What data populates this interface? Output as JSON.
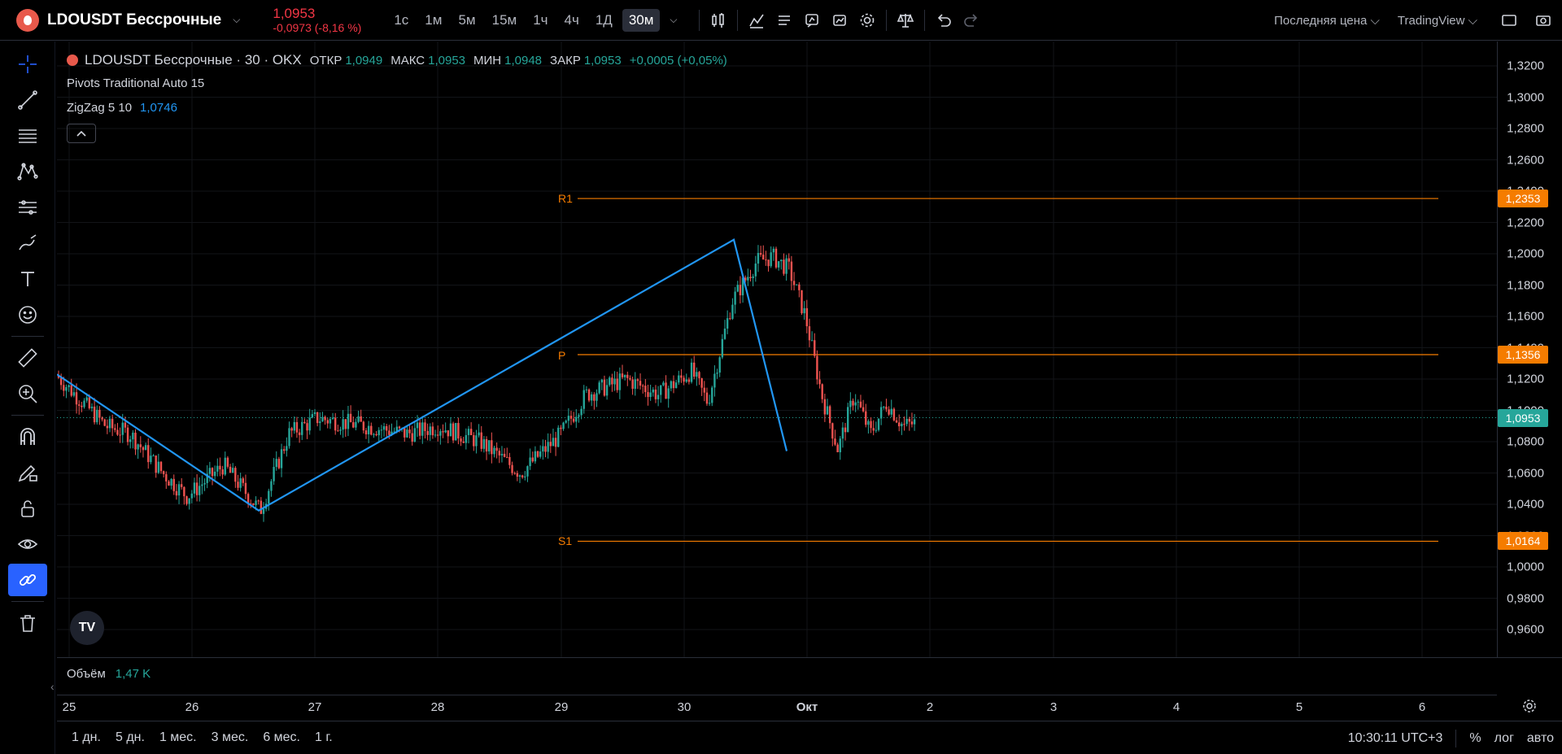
{
  "header": {
    "symbol": "LDOUSDT Бессрочные",
    "last_price": "1,0953",
    "change": "-0,0973 (-8,16 %)",
    "timeframes": [
      "1с",
      "1м",
      "5м",
      "15м",
      "1ч",
      "4ч",
      "1Д",
      "30м"
    ],
    "active_timeframe": "30м",
    "price_type": "Последняя цена",
    "broker": "TradingView"
  },
  "legend": {
    "title": "LDOUSDT Бессрочные · 30 · OKX",
    "open_label": "ОТКР",
    "open": "1,0949",
    "high_label": "МАКС",
    "high": "1,0953",
    "low_label": "МИН",
    "low": "1,0948",
    "close_label": "ЗАКР",
    "close": "1,0953",
    "change": "+0,0005 (+0,05%)"
  },
  "indicators": {
    "pivots": "Pivots Traditional Auto 15",
    "zigzag": "ZigZag 5 10",
    "zigzag_value": "1,0746"
  },
  "pivots": {
    "r1_label": "R1",
    "r1": "1,2353",
    "p_label": "P",
    "p": "1,1356",
    "s1_label": "S1",
    "s1": "1,0164"
  },
  "price_axis": {
    "ticks": [
      "1,3200",
      "1,3000",
      "1,2800",
      "1,2600",
      "1,2400",
      "1,2200",
      "1,2000",
      "1,1800",
      "1,1600",
      "1,1400",
      "1,1200",
      "1,1000",
      "1,0800",
      "1,0600",
      "1,0400",
      "1,0200",
      "1,0000",
      "0,9800",
      "0,9600"
    ],
    "current": "1,0953"
  },
  "volume": {
    "label": "Объём",
    "value": "1,47 K"
  },
  "time_axis": [
    "25",
    "26",
    "27",
    "28",
    "29",
    "30",
    "Окт",
    "2",
    "3",
    "4",
    "5",
    "6"
  ],
  "ranges": [
    "1 дн.",
    "5 дн.",
    "1 мес.",
    "3 мес.",
    "6 мес.",
    "1 г."
  ],
  "status": {
    "clock": "10:30:11 UTC+3",
    "percent": "%",
    "log": "лог",
    "auto": "авто"
  },
  "colors": {
    "up": "#26a69a",
    "down": "#ef5350",
    "zigzag": "#2196f3",
    "pivot": "#f57c00",
    "accent": "#2962ff"
  }
}
